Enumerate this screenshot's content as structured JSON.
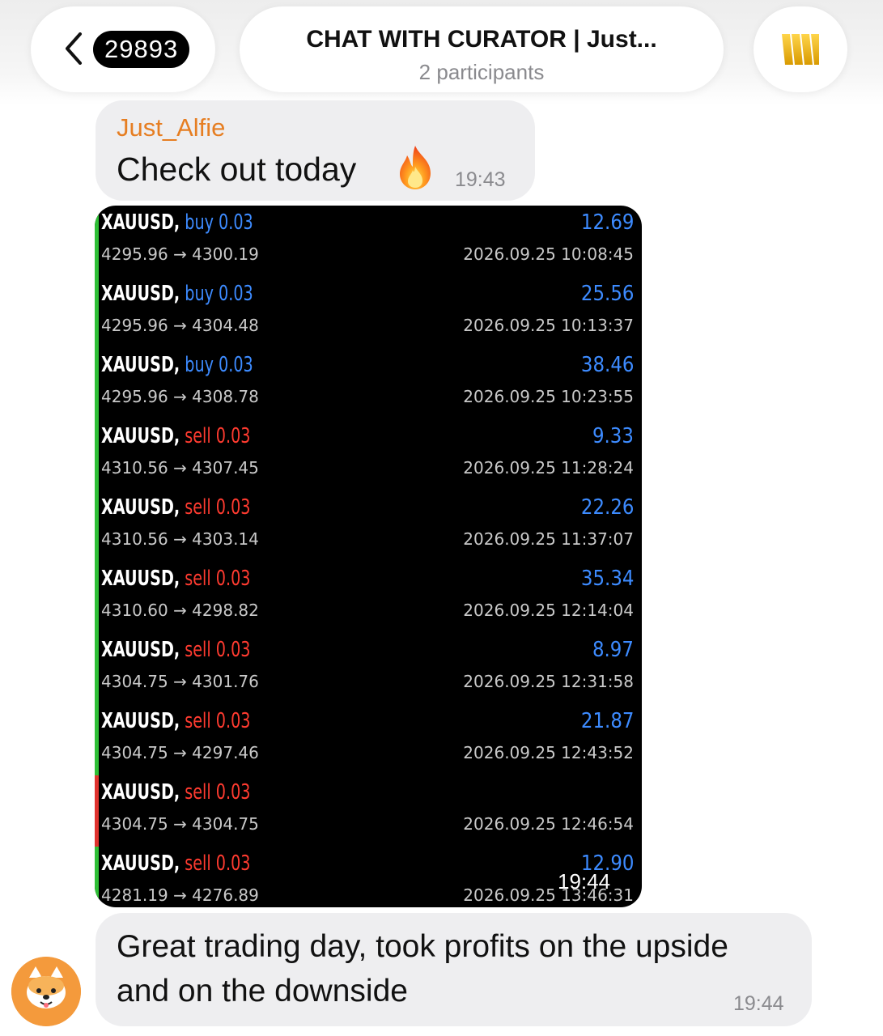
{
  "header": {
    "back_count": "29893",
    "title": "CHAT WITH CURATOR | Just...",
    "subtitle": "2 participants"
  },
  "messages": [
    {
      "sender": "Just_Alfie",
      "text": "Check out today",
      "emoji": "fire",
      "time": "19:43"
    },
    {
      "type": "photo",
      "time": "19:44"
    },
    {
      "text": "Great trading day, took profits on the upside and on the downside",
      "time": "19:44"
    }
  ],
  "trades": [
    {
      "symbol": "XAUUSD,",
      "side": "buy",
      "volume": "0.03",
      "open": "4295.96",
      "close": "4300.19",
      "profit": "12.69",
      "datetime": "2026.09.25 10:08:45",
      "bar": "green"
    },
    {
      "symbol": "XAUUSD,",
      "side": "buy",
      "volume": "0.03",
      "open": "4295.96",
      "close": "4304.48",
      "profit": "25.56",
      "datetime": "2026.09.25 10:13:37",
      "bar": "green"
    },
    {
      "symbol": "XAUUSD,",
      "side": "buy",
      "volume": "0.03",
      "open": "4295.96",
      "close": "4308.78",
      "profit": "38.46",
      "datetime": "2026.09.25 10:23:55",
      "bar": "green"
    },
    {
      "symbol": "XAUUSD,",
      "side": "sell",
      "volume": "0.03",
      "open": "4310.56",
      "close": "4307.45",
      "profit": "9.33",
      "datetime": "2026.09.25 11:28:24",
      "bar": "green"
    },
    {
      "symbol": "XAUUSD,",
      "side": "sell",
      "volume": "0.03",
      "open": "4310.56",
      "close": "4303.14",
      "profit": "22.26",
      "datetime": "2026.09.25 11:37:07",
      "bar": "green"
    },
    {
      "symbol": "XAUUSD,",
      "side": "sell",
      "volume": "0.03",
      "open": "4310.60",
      "close": "4298.82",
      "profit": "35.34",
      "datetime": "2026.09.25 12:14:04",
      "bar": "green"
    },
    {
      "symbol": "XAUUSD,",
      "side": "sell",
      "volume": "0.03",
      "open": "4304.75",
      "close": "4301.76",
      "profit": "8.97",
      "datetime": "2026.09.25 12:31:58",
      "bar": "green"
    },
    {
      "symbol": "XAUUSD,",
      "side": "sell",
      "volume": "0.03",
      "open": "4304.75",
      "close": "4297.46",
      "profit": "21.87",
      "datetime": "2026.09.25 12:43:52",
      "bar": "green"
    },
    {
      "symbol": "XAUUSD,",
      "side": "sell",
      "volume": "0.03",
      "open": "4304.75",
      "close": "4304.75",
      "profit": "",
      "datetime": "2026.09.25 12:46:54",
      "bar": "red"
    },
    {
      "symbol": "XAUUSD,",
      "side": "sell",
      "volume": "0.03",
      "open": "4281.19",
      "close": "4276.89",
      "profit": "12.90",
      "datetime": "2026.09.25 13:46:31",
      "bar": "green"
    }
  ],
  "colors": {
    "buy": "#3d8bff",
    "sell": "#ff3b30",
    "profit": "#3d8bff",
    "sender": "#e67e22"
  },
  "icons": {
    "back": "chevron-left-icon",
    "group": "crown-bars-icon",
    "emoji": "fire-icon",
    "avatar": "dog-avatar-icon"
  }
}
